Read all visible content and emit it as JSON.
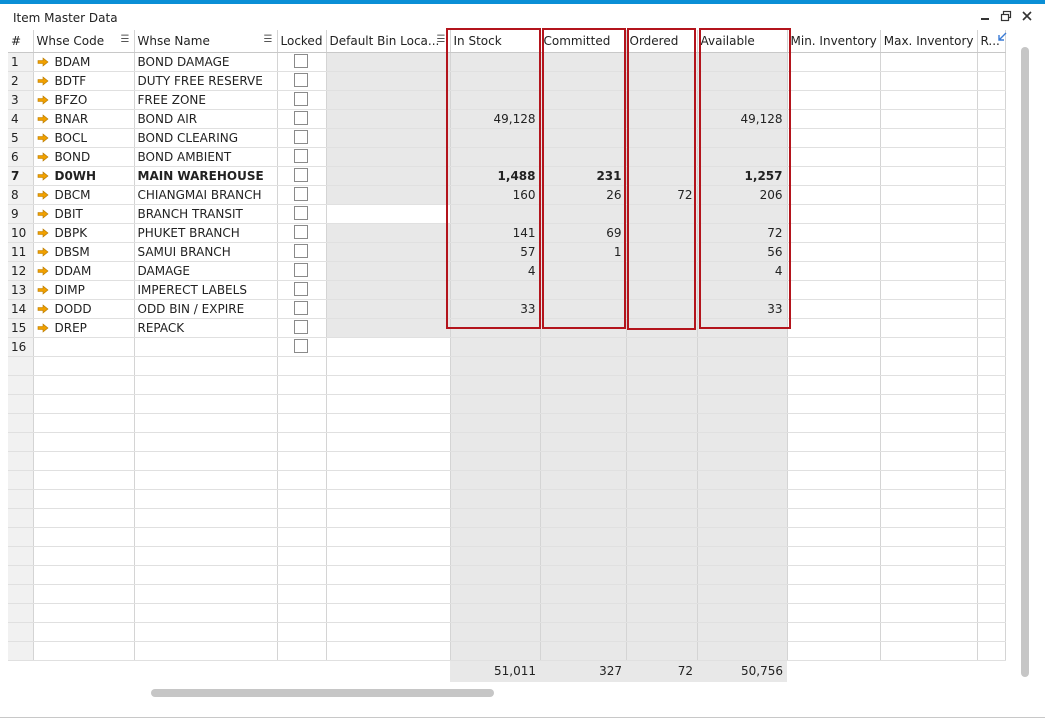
{
  "window": {
    "title": "Item Master Data",
    "controls": [
      "minimize-icon",
      "restore-icon",
      "close-icon"
    ]
  },
  "columns": [
    "#",
    "Whse Code",
    "Whse Name",
    "Locked",
    "Default Bin Loca...",
    "In Stock",
    "Committed",
    "Ordered",
    "Available",
    "Min. Inventory",
    "Max. Inventory",
    "R..."
  ],
  "rows": [
    {
      "n": "1",
      "code": "BDAM",
      "name": "BOND DAMAGE",
      "in_stock": "",
      "committed": "",
      "ordered": "",
      "available": ""
    },
    {
      "n": "2",
      "code": "BDTF",
      "name": "DUTY FREE RESERVE",
      "in_stock": "",
      "committed": "",
      "ordered": "",
      "available": ""
    },
    {
      "n": "3",
      "code": "BFZO",
      "name": "FREE ZONE",
      "in_stock": "",
      "committed": "",
      "ordered": "",
      "available": ""
    },
    {
      "n": "4",
      "code": "BNAR",
      "name": "BOND AIR",
      "in_stock": "49,128",
      "committed": "",
      "ordered": "",
      "available": "49,128"
    },
    {
      "n": "5",
      "code": "BOCL",
      "name": "BOND CLEARING",
      "in_stock": "",
      "committed": "",
      "ordered": "",
      "available": ""
    },
    {
      "n": "6",
      "code": "BOND",
      "name": "BOND AMBIENT",
      "in_stock": "",
      "committed": "",
      "ordered": "",
      "available": ""
    },
    {
      "n": "7",
      "code": "D0WH",
      "name": "MAIN WAREHOUSE",
      "in_stock": "1,488",
      "committed": "231",
      "ordered": "",
      "available": "1,257"
    },
    {
      "n": "8",
      "code": "DBCM",
      "name": "CHIANGMAI BRANCH",
      "in_stock": "160",
      "committed": "26",
      "ordered": "72",
      "available": "206"
    },
    {
      "n": "9",
      "code": "DBIT",
      "name": "BRANCH TRANSIT",
      "in_stock": "",
      "committed": "",
      "ordered": "",
      "available": ""
    },
    {
      "n": "10",
      "code": "DBPK",
      "name": "PHUKET BRANCH",
      "in_stock": "141",
      "committed": "69",
      "ordered": "",
      "available": "72"
    },
    {
      "n": "11",
      "code": "DBSM",
      "name": "SAMUI BRANCH",
      "in_stock": "57",
      "committed": "1",
      "ordered": "",
      "available": "56"
    },
    {
      "n": "12",
      "code": "DDAM",
      "name": "DAMAGE",
      "in_stock": "4",
      "committed": "",
      "ordered": "",
      "available": "4"
    },
    {
      "n": "13",
      "code": "DIMP",
      "name": "IMPERECT LABELS",
      "in_stock": "",
      "committed": "",
      "ordered": "",
      "available": ""
    },
    {
      "n": "14",
      "code": "DODD",
      "name": "ODD BIN / EXPIRE",
      "in_stock": "33",
      "committed": "",
      "ordered": "",
      "available": "33"
    },
    {
      "n": "15",
      "code": "DREP",
      "name": "REPACK",
      "in_stock": "",
      "committed": "",
      "ordered": "",
      "available": ""
    },
    {
      "n": "16",
      "code": "",
      "name": "",
      "in_stock": "",
      "committed": "",
      "ordered": "",
      "available": ""
    }
  ],
  "totals": {
    "in_stock": "51,011",
    "committed": "327",
    "ordered": "72",
    "available": "50,756"
  },
  "colors": {
    "accent": "#0a8fd6",
    "highlight_border": "#b3141c",
    "arrow": "#f0a000",
    "readonly_cell": "#e8e8e8"
  }
}
